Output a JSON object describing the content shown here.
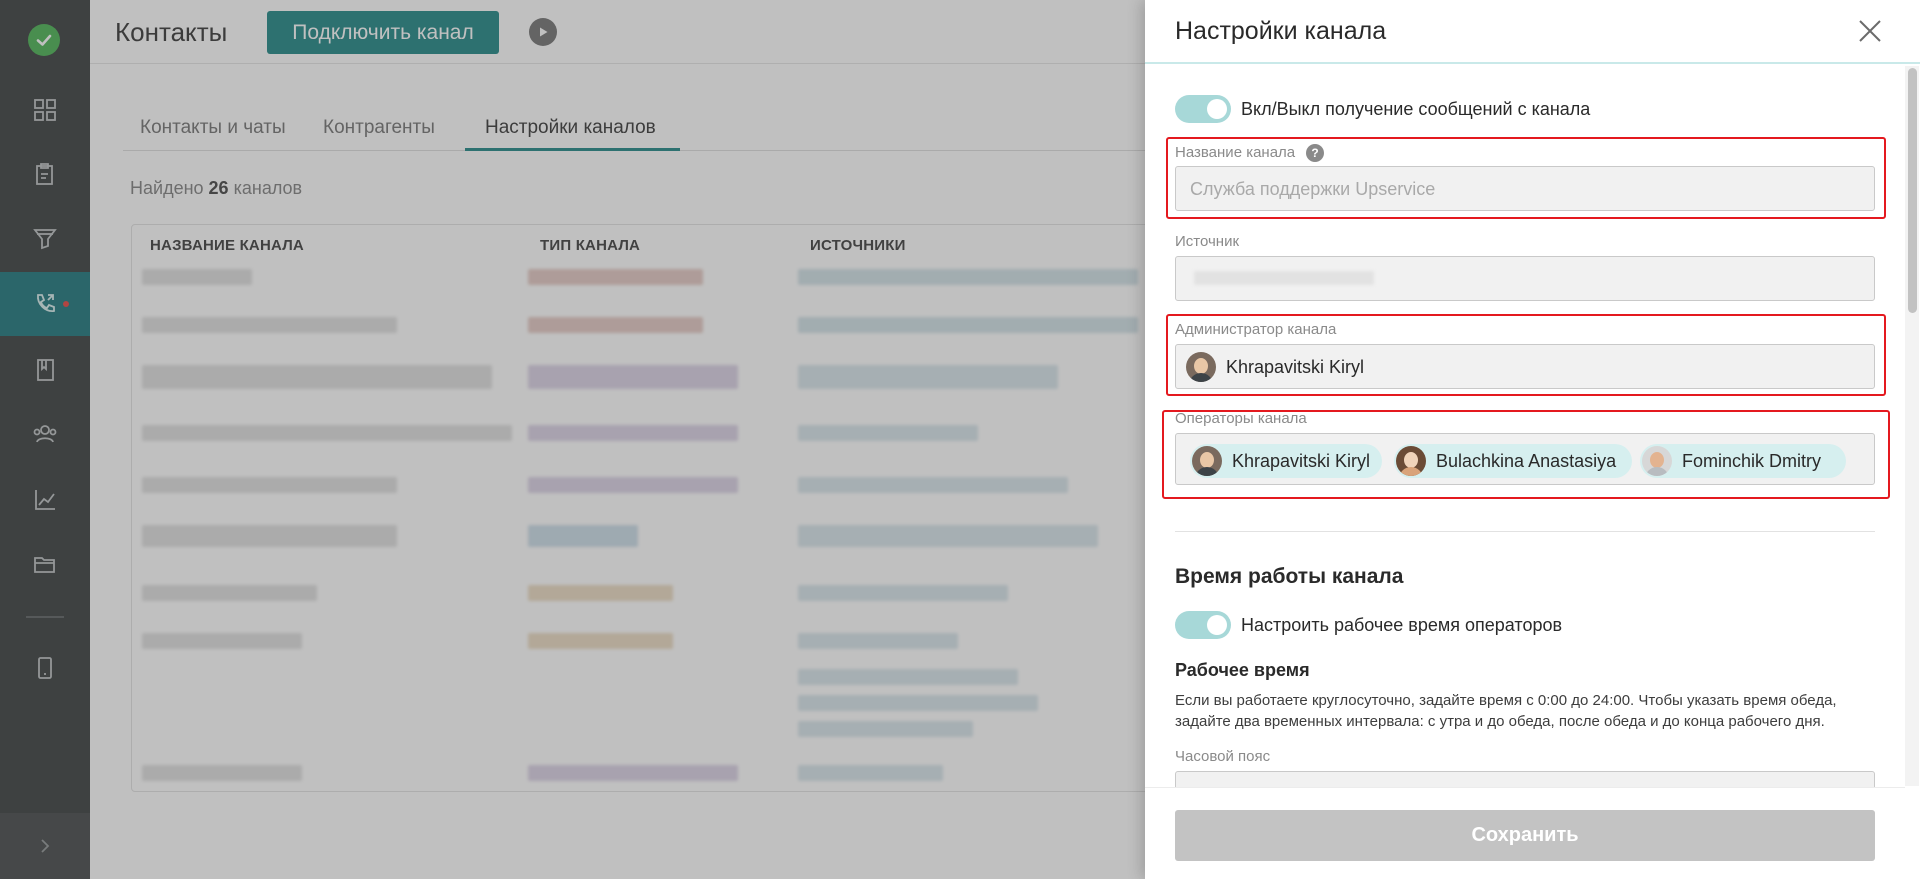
{
  "header": {
    "title": "Контакты",
    "connect_button": "Подключить канал"
  },
  "tabs": [
    {
      "label": "Контакты и чаты"
    },
    {
      "label": "Контрагенты"
    },
    {
      "label": "Настройки каналов"
    }
  ],
  "summary": {
    "prefix": "Найдено",
    "count": "26",
    "suffix": "каналов"
  },
  "table": {
    "columns": [
      "НАЗВАНИЕ КАНАЛА",
      "ТИП КАНАЛА",
      "ИСТОЧНИКИ"
    ]
  },
  "panel": {
    "title": "Настройки канала",
    "toggle_receive_label": "Вкл/Выкл получение сообщений с канала",
    "channel_name": {
      "label": "Название канала",
      "placeholder": "Служба поддержки Upservice"
    },
    "source": {
      "label": "Источник"
    },
    "admin": {
      "label": "Администратор канала",
      "value": "Khrapavitski Kiryl"
    },
    "operators": {
      "label": "Операторы канала",
      "items": [
        {
          "name": "Khrapavitski Kiryl"
        },
        {
          "name": "Bulachkina Anastasiya"
        },
        {
          "name": "Fominchik Dmitry"
        }
      ]
    },
    "work_time": {
      "section_title": "Время работы канала",
      "toggle_label": "Настроить рабочее время операторов",
      "subtitle": "Рабочее время",
      "hint": "Если вы работаете круглосуточно, задайте время с 0:00 до 24:00. Чтобы указать время обеда, задайте два временных интервала: с утра и до обеда, после обеда и до конца рабочего дня.",
      "timezone_label": "Часовой пояс"
    },
    "save_button": "Сохранить"
  },
  "colors": {
    "accent": "#12807f",
    "highlight": "#e4191f",
    "sidebar": "#2e3233"
  }
}
